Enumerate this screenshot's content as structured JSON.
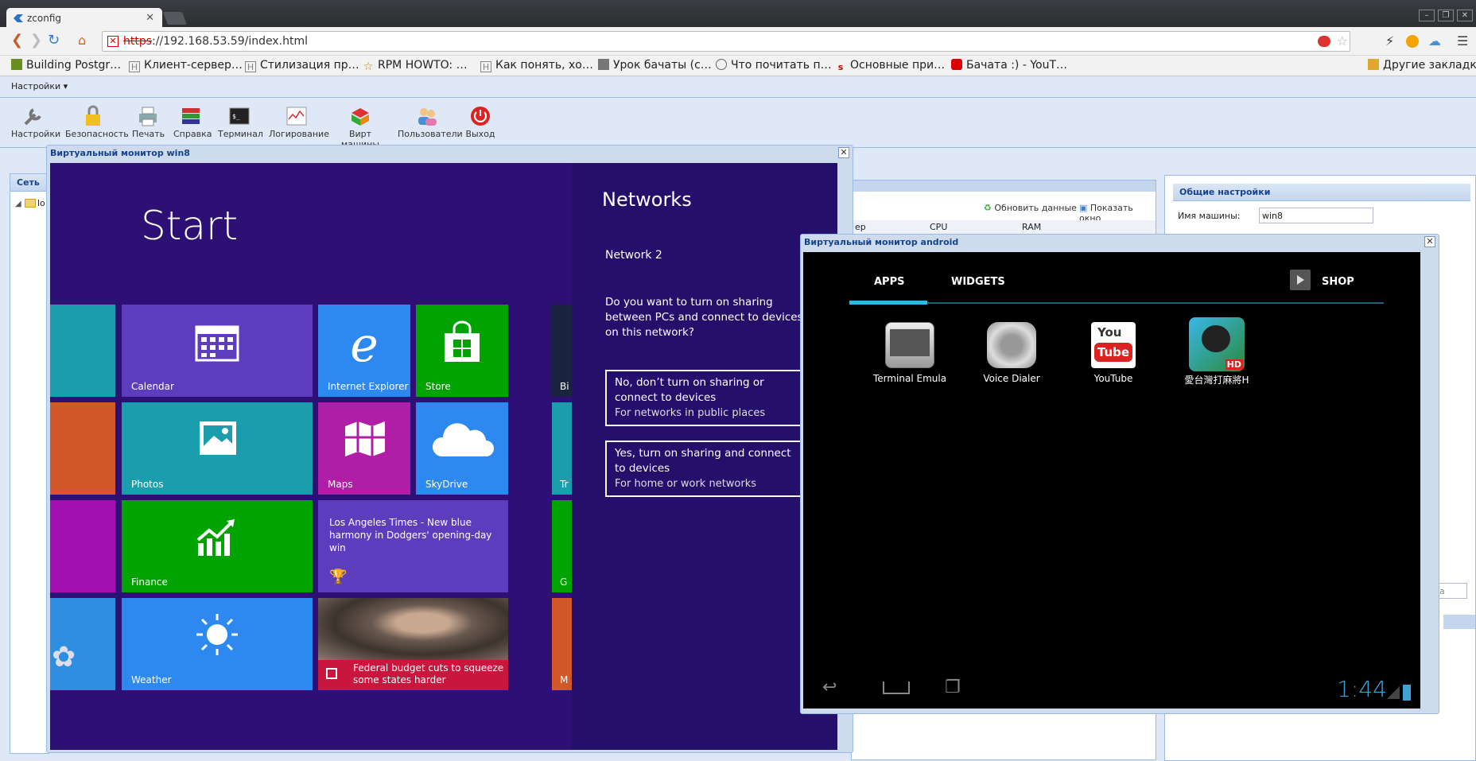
{
  "browser": {
    "tab_title": "zconfig",
    "tab_close": "✕",
    "url_scheme": "https",
    "url_rest": "://192.168.53.59/index.html",
    "bookmarks": [
      {
        "label": "Building Postgr…",
        "icon": "bookmark-icon"
      },
      {
        "label": "Клиент-сервер…",
        "icon": "habr-icon"
      },
      {
        "label": "Стилизация пр…",
        "icon": "habr-icon"
      },
      {
        "label": "RPM HOWTO: …",
        "icon": "star-icon"
      },
      {
        "label": "Как понять, хо…",
        "icon": "habr-icon"
      },
      {
        "label": "Урок бачаты (с…",
        "icon": "page-icon"
      },
      {
        "label": "Что почитать п…",
        "icon": "page-icon"
      },
      {
        "label": "Основные при…",
        "icon": "page-icon"
      },
      {
        "label": "Бачата :) - YouT…",
        "icon": "youtube-icon"
      }
    ],
    "other_bookmarks": "Другие закладки"
  },
  "app": {
    "menu_label": "Настройки ▾",
    "tools": [
      "Настройки",
      "Безопасность",
      "Печать",
      "Справка",
      "Терминал",
      "Логирование",
      "Вирт машины",
      "Пользователи",
      "Выход"
    ],
    "left_panel_title": "Сеть",
    "tree_item": "lo",
    "grid_refresh": "Обновить данные",
    "grid_show": "Показать окно",
    "grid_cols": [
      "ер",
      "CPU",
      "RAM"
    ],
    "settings_title": "Общие настройки",
    "machine_name_label": "Имя машины:",
    "machine_name_value": "win8",
    "partial_a": "a"
  },
  "win8_window": {
    "title": "Виртуальный монитор win8",
    "start_label": "Start",
    "tiles": {
      "calendar": "Calendar",
      "ie": "Internet Explorer",
      "store": "Store",
      "photos": "Photos",
      "maps": "Maps",
      "skydrive": "SkyDrive",
      "finance": "Finance",
      "news_text": "Los Angeles Times - New blue harmony in Dodgers' opening-day win",
      "weather": "Weather",
      "federal_text": "Federal budget cuts to squeeze some states harder",
      "partial_bi": "Bi",
      "partial_tr": "Tr",
      "partial_g": "G",
      "partial_m": "M"
    },
    "networks": {
      "title": "Networks",
      "network_name": "Network  2",
      "question": "Do you want to turn on sharing between PCs and connect to devices on this network?",
      "option_no": "No, don’t turn on sharing or connect to devices",
      "option_no_sub": "For networks in public places",
      "option_yes": "Yes, turn on sharing and connect to devices",
      "option_yes_sub": "For home or work networks"
    }
  },
  "android_window": {
    "title": "Виртуальный монитор android",
    "tab_apps": "APPS",
    "tab_widgets": "WIDGETS",
    "shop": "SHOP",
    "apps": [
      "Terminal Emula",
      "Voice Dialer",
      "YouTube",
      "愛台灣打麻將H"
    ],
    "youtube_you": "You",
    "youtube_tube": "Tube",
    "clock": "1:44"
  },
  "colors": {
    "accent": "#15428b",
    "win8_bg": "#2e0f73",
    "android_accent": "#33b5e5"
  }
}
